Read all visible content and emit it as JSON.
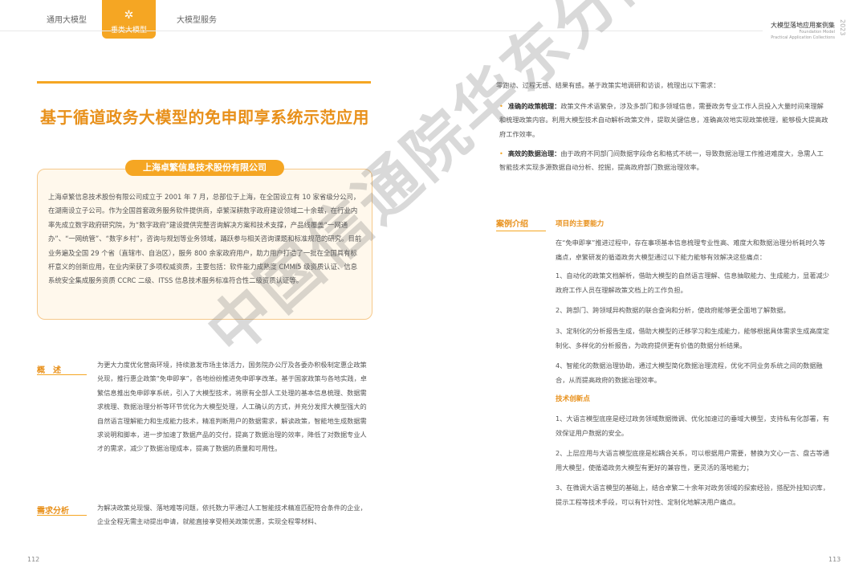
{
  "nav": {
    "tab1": "通用大模型",
    "tab2": "垂类大模型",
    "tab3": "大模型服务"
  },
  "header": {
    "title": "大模型落地应用案例集",
    "sub1": "Foundation Model",
    "sub2": "Practical Application Collections",
    "year": "2023"
  },
  "left": {
    "title": "基于循道政务大模型的免申即享系统示范应用",
    "company": "上海卓繁信息技术股份有限公司",
    "company_intro": "上海卓繁信息技术股份有限公司成立于 2001 年 7 月，总部位于上海，在全国设立有 10 家省级分公司，在湖南设立子公司。作为全国首套政务服务软件提供商，卓繁深耕数字政府建设领域二十余载，在行业内率先成立数字政府研究院，为“数字政府”建设提供完整咨询解决方案和技术支撑，产品线覆盖“一网通办”、“一网统管”、“数字乡村”，咨询与规划等业务领域，踊跃参与相关咨询课题和标准规范的研究。目前业务遍及全国 29 个省（直辖市、自治区），服务 800 余家政府用户，助力用户打造了一批在全国具有标杆意义的创新应用，在业内荣获了多项权威资质，主要包括：软件能力成熟度 CMMI5 级资质认证、信息系统安全集成服务资质 CCRC 二级、ITSS 信息技术服务标准符合性二级资质认证等。",
    "overview_label": "概　述",
    "overview_text": "为更大力度优化营商环境，持续激发市场主体活力，国务院办公厅及各委办积极制定惠企政策兑现，推行惠企政策“免申即享”，各地纷纷推进免申即享改革。基于国家政策与各地实践，卓繁信息推出免申即享系统，引入了大模型技术，将原有全部人工处理的基本信息梳理、数据需求梳理、数据治理分析等环节优化为大模型处理，人工确认的方式，并充分发挥大模型强大的自然语言理解能力和生成能力技术，精准判断用户的数据需求，解读政策，智能地生成数据需求说明和脚本，进一步加速了数据产品的交付，提高了数据治理的效率，降低了对数据专业人才的需求，减少了数据治理成本，提高了数据的质量和可用性。",
    "demand_label": "需求分析",
    "demand_text": "为解决政策兑现慢、落地难等问题，依托数力平通过人工智能技术精准匹配符合条件的企业，企业全程无需主动提出申请，就能直接享受相关政策优惠，实现全程零材料、",
    "page_num": "112"
  },
  "right": {
    "top_text": "零跑动、过程无感、结果有感。基于政策实地调研和访谈，梳理出以下需求：",
    "bullet1_title": "准确的政策梳理：",
    "bullet1_text": "政策文件术语繁杂，涉及多部门和多领域信息，需要政务专业工作人员投入大量时间来理解和梳理政策内容。利用大模型技术自动解析政策文件，提取关键信息，准确高效地实现政策梳理，能够极大提高政府工作效率。",
    "bullet2_title": "高效的数据治理：",
    "bullet2_text": "由于政府不同部门间数据字段命名和格式不统一，导致数据治理工作推进难度大，急需人工智能技术实现多源数据自动分析、挖掘，提高政府部门数据治理效率。",
    "case_label": "案例介绍",
    "main_ability": "项目的主要能力",
    "ability_intro": "在“免申即享”推进过程中，存在事项基本信息梳理专业性高、难度大和数据治理分析耗时久等痛点，卓繁研发的循道政务大模型通过以下能力能够有效解决这些痛点：",
    "ability1": "1、自动化的政策文档解析，借助大模型的自然语言理解、信息抽取能力、生成能力，显著减少政府工作人员在理解政策文档上的工作负担。",
    "ability2": "2、跨部门、跨领域异构数据的联合查询和分析，使政府能够更全面地了解数据。",
    "ability3": "3、定制化的分析报告生成，借助大模型的迁移学习和生成能力，能够根据具体需求生成高度定制化、多样化的分析报告，为政府提供更有价值的数据分析结果。",
    "ability4": "4、智能化的数据治理协助，通过大模型简化数据治理流程，优化不同业务系统之间的数据融合，从而提高政府的数据治理效率。",
    "innovation": "技术创新点",
    "innov1": "1、大语言模型底座是经过政务领域数据微调、优化加速过的垂域大模型，支持私有化部署，有效保证用户数据的安全。",
    "innov2": "2、上层应用与大语言模型底座是松耦合关系，可以根据用户需要，替换为文心一言、盘古等通用大模型，使循道政务大模型有更好的兼容性，更灵活的落地能力；",
    "innov3": "3、在微调大语言模型的基础上，结合卓繁二十余年对政务领域的探索经验，搭配外挂知识库，提示工程等技术手段，可以有针对性、定制化地解决用户痛点。",
    "page_num": "113"
  },
  "watermark": "中国信通院华东分院"
}
